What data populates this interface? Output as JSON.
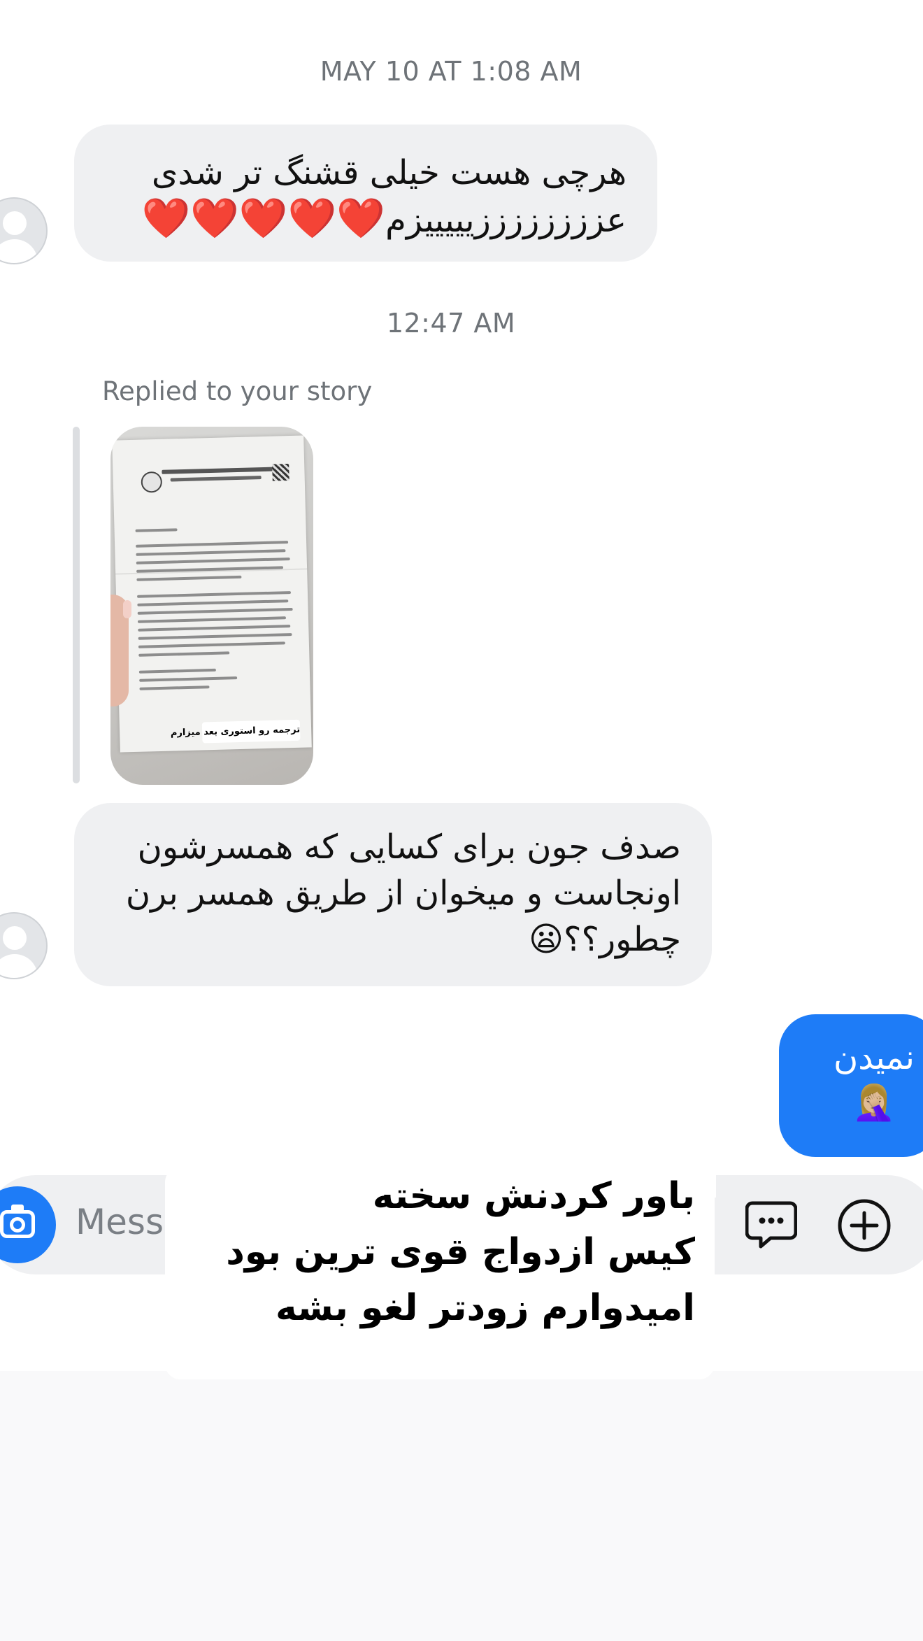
{
  "timestamps": {
    "first": "MAY 10 AT 1:08 AM",
    "second": "12:47 AM"
  },
  "messages": [
    {
      "direction": "incoming",
      "lines": [
        "هرچی هست خیلی قشنگ تر شدی",
        "عززززززززیییییزم"
      ],
      "hearts": "❤️❤️❤️❤️❤️"
    },
    {
      "direction": "incoming",
      "reply_label": "Replied to your story",
      "story_sticker": "ترجمه رو استوری بعد میزارم",
      "lines": [
        "صدف جون برای کسایی که همسرشون",
        "اونجاست و میخوان از طریق همسر برن",
        "چطور؟؟"
      ],
      "emoji": "😦"
    },
    {
      "direction": "outgoing",
      "text": "نمیدن",
      "emoji": "🤦🏼‍♀️"
    }
  ],
  "composer": {
    "placeholder": "Message...",
    "visible_placeholder": "Mess",
    "camera_icon": "camera-icon",
    "sticker_icon": "chat-bubble-icon",
    "add_icon": "plus-circle-icon"
  },
  "overlay": {
    "lines": [
      "باور کردنش سخته",
      "کیس ازدواج قوی ترین بود",
      "امیدوارم زودتر لغو بشه"
    ]
  },
  "colors": {
    "outgoing_bubble": "#1e7cf7",
    "incoming_bubble": "#eff0f2",
    "timestamp": "#6e7378"
  }
}
